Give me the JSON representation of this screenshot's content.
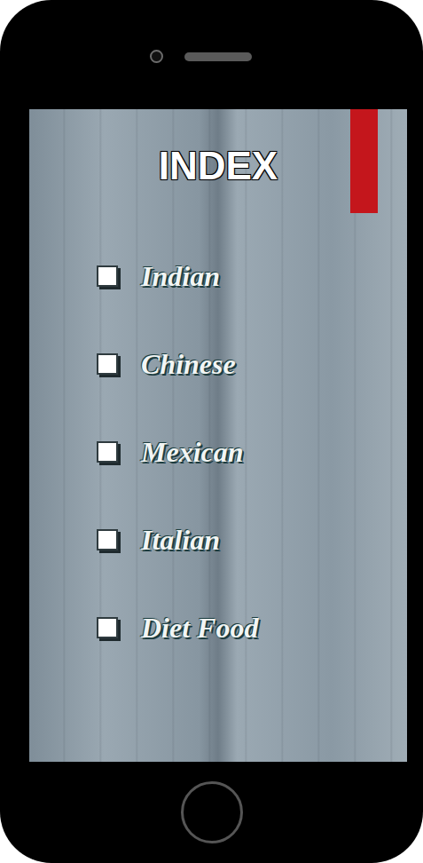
{
  "screen": {
    "title": "INDEX"
  },
  "items": [
    {
      "label": "Indian",
      "checked": false
    },
    {
      "label": "Chinese",
      "checked": false
    },
    {
      "label": "Mexican",
      "checked": false
    },
    {
      "label": "Italian",
      "checked": false
    },
    {
      "label": "Diet Food",
      "checked": false
    }
  ]
}
